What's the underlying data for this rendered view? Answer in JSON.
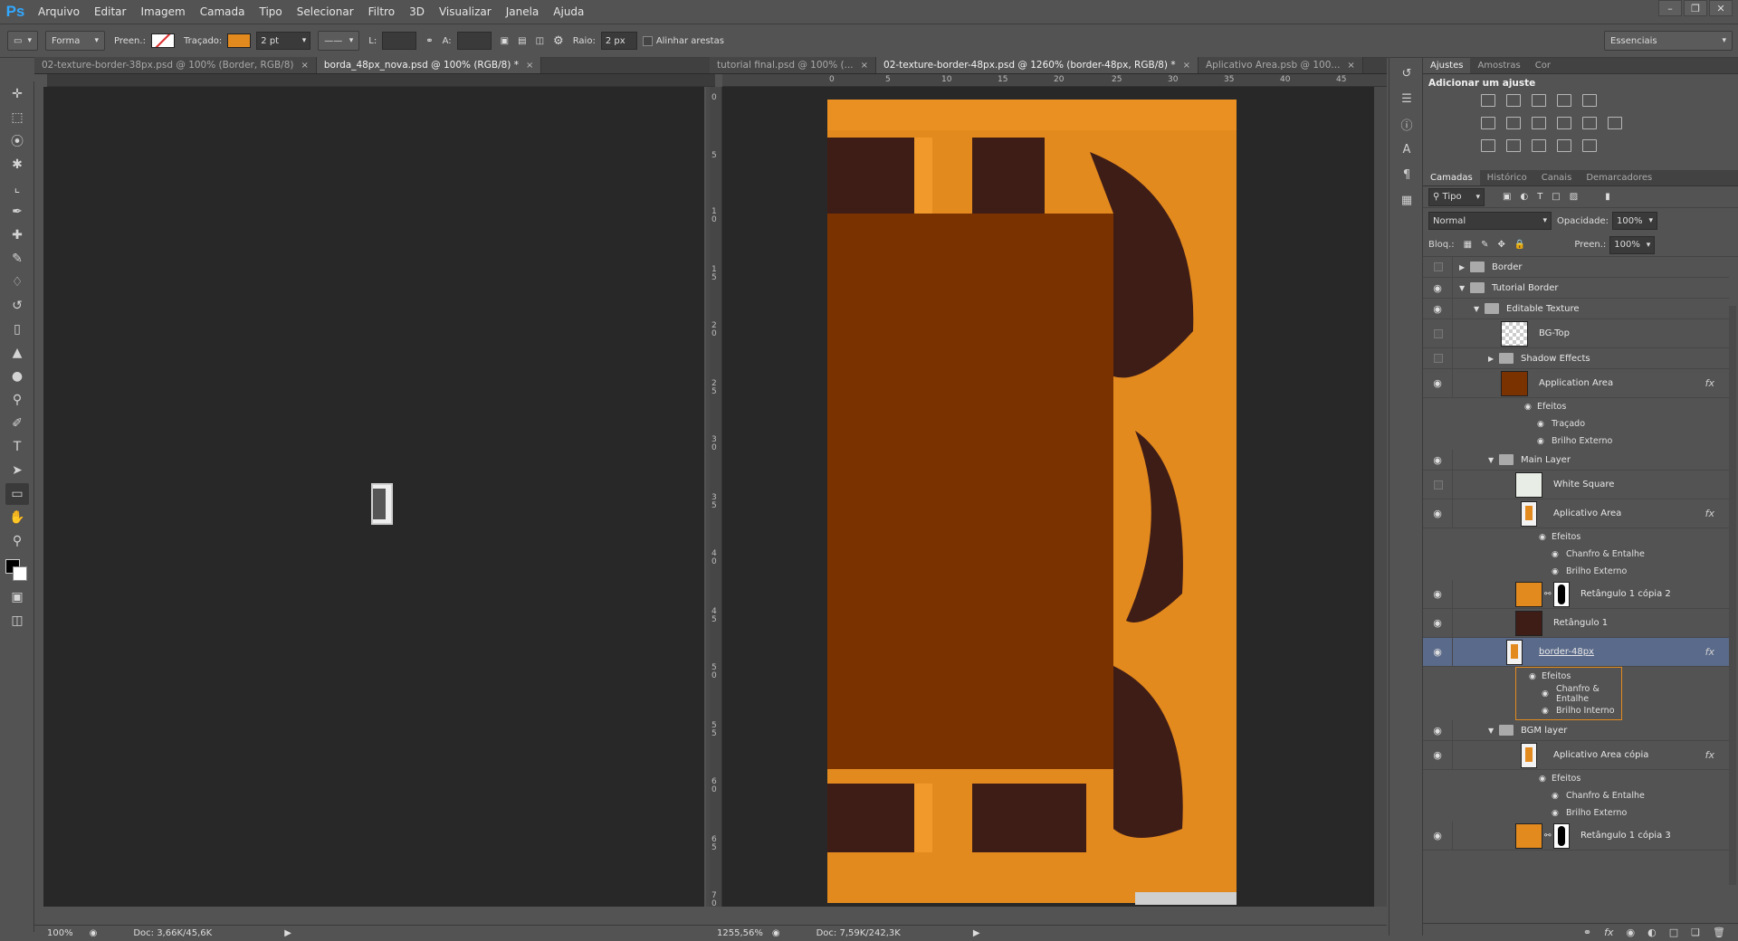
{
  "menubar": {
    "logo": "Ps",
    "items": [
      "Arquivo",
      "Editar",
      "Imagem",
      "Camada",
      "Tipo",
      "Selecionar",
      "Filtro",
      "3D",
      "Visualizar",
      "Janela",
      "Ajuda"
    ]
  },
  "options": {
    "shape_mode": "Forma",
    "fill_label": "Preen.:",
    "stroke_label": "Traçado:",
    "stroke_color": "#e38a1e",
    "stroke_width": "2 pt",
    "w_label": "L:",
    "h_label": "A:",
    "radius_label": "Raio:",
    "radius_value": "2 px",
    "align_edges": "Alinhar arestas",
    "workspace": "Essenciais"
  },
  "left_doc": {
    "tabs": [
      {
        "label": "02-texture-border-38px.psd @ 100% (Border, RGB/8)",
        "close": "×"
      },
      {
        "label": "borda_48px_nova.psd @ 100% (RGB/8) *",
        "close": "×"
      }
    ],
    "zoom": "100%",
    "doc": "Doc: 3,66K/45,6K"
  },
  "right_doc": {
    "tabs": [
      {
        "label": "tutorial final.psd @ 100% (...",
        "close": "×"
      },
      {
        "label": "02-texture-border-48px.psd @ 1260% (border-48px, RGB/8) *",
        "close": "×"
      },
      {
        "label": "Aplicativo Area.psb @ 100...",
        "close": "×"
      }
    ],
    "ruler_h": [
      "0",
      "5",
      "10",
      "15",
      "20",
      "25",
      "30",
      "35",
      "40",
      "45"
    ],
    "ruler_v": [
      "0",
      "5",
      "10",
      "15",
      "20",
      "25",
      "30",
      "35",
      "40",
      "45",
      "50",
      "55",
      "60",
      "65",
      "70"
    ],
    "zoom": "1255,56%",
    "doc": "Doc: 7,59K/242,3K"
  },
  "adjust_panel": {
    "tabs": [
      "Ajustes",
      "Amostras",
      "Cor"
    ],
    "title": "Adicionar um ajuste"
  },
  "layers_panel": {
    "tabs": [
      "Camadas",
      "Histórico",
      "Canais",
      "Demarcadores"
    ],
    "filter": "Tipo",
    "blend": "Normal",
    "opacity_label": "Opacidade:",
    "opacity": "100%",
    "lock_label": "Bloq.:",
    "fill_label": "Preen.:",
    "fill": "100%",
    "layers": [
      {
        "name": "Border",
        "kind": "group",
        "indent": 0,
        "eye": false,
        "open": false
      },
      {
        "name": "Tutorial Border",
        "kind": "group",
        "indent": 0,
        "eye": true,
        "open": true
      },
      {
        "name": "Editable Texture",
        "kind": "group",
        "indent": 1,
        "eye": true,
        "open": true
      },
      {
        "name": "BG-Top",
        "kind": "layer",
        "indent": 2,
        "eye": false,
        "thumb": "checker"
      },
      {
        "name": "Shadow Effects",
        "kind": "group",
        "indent": 2,
        "eye": false,
        "open": false
      },
      {
        "name": "Application Area",
        "kind": "layer",
        "indent": 2,
        "eye": true,
        "thumb": "#7a3300",
        "fx": true,
        "effects": [
          "Efeitos",
          "Traçado",
          "Brilho Externo"
        ]
      },
      {
        "name": "Main Layer",
        "kind": "group",
        "indent": 2,
        "eye": true,
        "open": true
      },
      {
        "name": "White Square",
        "kind": "layer",
        "indent": 3,
        "eye": false,
        "thumb": "#e8eee6"
      },
      {
        "name": "Aplicativo Area",
        "kind": "layer",
        "indent": 3,
        "eye": true,
        "thumb": "smart",
        "fx": true,
        "effects": [
          "Efeitos",
          "Chanfro & Entalhe",
          "Brilho Externo"
        ]
      },
      {
        "name": "Retângulo 1 cópia 2",
        "kind": "layer",
        "indent": 3,
        "eye": true,
        "thumb": "#e38a1e",
        "mask": true
      },
      {
        "name": "Retângulo 1",
        "kind": "layer",
        "indent": 3,
        "eye": true,
        "thumb": "#3f1d17"
      },
      {
        "name": "border-48px",
        "kind": "layer",
        "indent": 2,
        "eye": true,
        "thumb": "smart",
        "fx": true,
        "selected": true,
        "effects": [
          "Efeitos",
          "Chanfro & Entalhe",
          "Brilho Interno"
        ]
      },
      {
        "name": "BGM layer",
        "kind": "group",
        "indent": 2,
        "eye": true,
        "open": true
      },
      {
        "name": "Aplicativo Area cópia",
        "kind": "layer",
        "indent": 3,
        "eye": true,
        "thumb": "smart",
        "fx": true,
        "effects": [
          "Efeitos",
          "Chanfro & Entalhe",
          "Brilho Externo"
        ]
      },
      {
        "name": "Retângulo 1 cópia 3",
        "kind": "layer",
        "indent": 3,
        "eye": true,
        "thumb": "#e38a1e",
        "mask": true
      }
    ]
  },
  "colors": {
    "orange": "#e38a1e",
    "brown": "#7a3300",
    "dark": "#3f1d17",
    "selection": "#5a6a8a",
    "highlight": "#e38a1e"
  }
}
